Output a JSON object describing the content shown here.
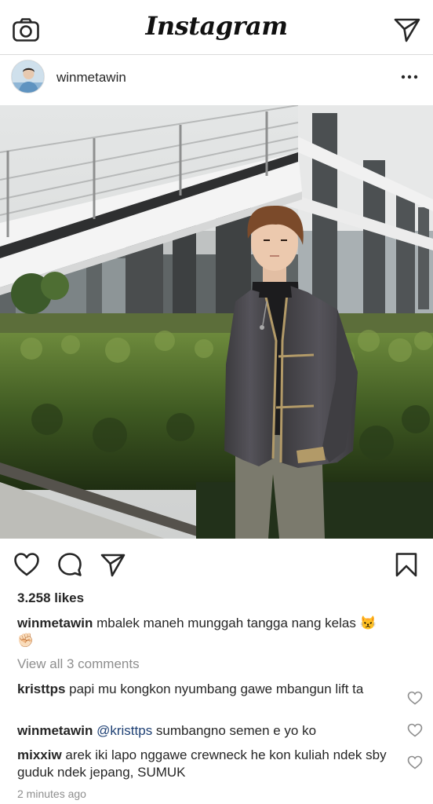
{
  "header": {
    "logo_text": "Instagram",
    "camera_icon": "camera-icon",
    "direct_icon": "paper-plane-icon"
  },
  "post": {
    "username": "winmetawin",
    "more_icon": "more-horizontal-icon",
    "image_description_icon": "photo"
  },
  "actions": {
    "like_icon": "heart-icon",
    "comment_icon": "comment-icon",
    "share_icon": "paper-plane-icon",
    "save_icon": "bookmark-icon"
  },
  "likes": "3.258 likes",
  "caption": {
    "username": "winmetawin",
    "text": " mbalek maneh munggah tangga nang kelas",
    "emoji_1": "😾",
    "emoji_2": "✊🏻"
  },
  "view_all": "View all 3 comments",
  "comments": [
    {
      "username": "kristtps",
      "text": " papi mu kongkon nyumbang gawe mbangun lift ta"
    },
    {
      "username": "winmetawin",
      "mention": "@kristtps",
      "text": " sumbangno semen e yo ko"
    },
    {
      "username": "mixxiw",
      "text": " arek iki lapo nggawe crewneck he kon kuliah ndek sby guduk ndek jepang, SUMUK"
    }
  ],
  "timestamp": "2 minutes ago"
}
